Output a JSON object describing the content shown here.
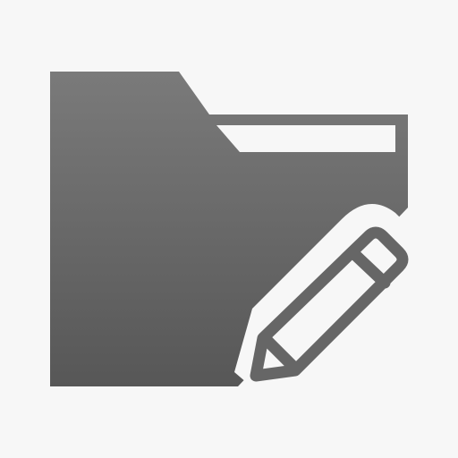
{
  "icon": {
    "name": "folder-edit-icon",
    "parts": [
      "folder",
      "pencil"
    ]
  },
  "colors": {
    "background": "#f7f7f7",
    "folder_top": "#7a7a7a",
    "folder_bottom": "#575757",
    "pencil_outline": "#666666",
    "pencil_fill": "#ffffff"
  }
}
